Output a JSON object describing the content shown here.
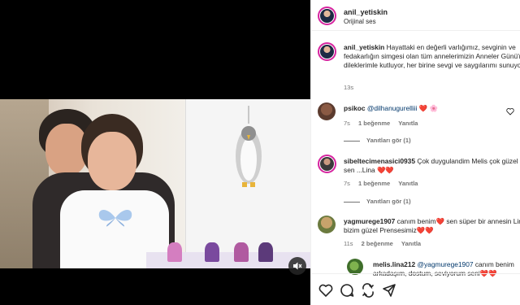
{
  "post": {
    "author": "anil_yetiskin",
    "audio": "Orijinal ses",
    "caption_author": "anil_yetiskin",
    "caption_text": "Hayattaki en değerli varlığımız, sevginin ve fedakarlığın simgesi olan tüm annelerimizin Anneler Günü'nü içten dileklerimle kutluyor, her birine sevgi ve saygılarımı sunuyorum.",
    "caption_time": "13s"
  },
  "comments": [
    {
      "username": "psikoc",
      "text": "@dilhanugurelliii",
      "emojis": "❤️ 🌸",
      "time": "7s",
      "likes": "1 beğenme",
      "reply_label": "Yanıtla",
      "view_replies": "Yanıtları gör (1)"
    },
    {
      "username": "sibeltecimenasici0935",
      "text": "Çok duygulandim Melis çok güzel annesin sen ...Lina",
      "emojis": "❤️❤️",
      "time": "7s",
      "likes": "1 beğenme",
      "reply_label": "Yanıtla",
      "view_replies": "Yanıtları gör (1)"
    },
    {
      "username": "yagmurege1907",
      "text": "canım benim❤️ sen süper bir annesin Linaaa o bizim güzel Prensesimiz❤️❤️",
      "time": "11s",
      "likes": "2 beğenme",
      "reply_label": "Yanıtla"
    },
    {
      "username": "melis.lina212",
      "mention": "@yagmurege1907",
      "text": "canım benim arkadaşım, dostum, seviyorum seni❤️❤️"
    }
  ],
  "icons": {
    "like": "heart-outline-icon",
    "comment": "comment-icon",
    "share": "share-icon",
    "send": "send-icon",
    "mute": "speaker-muted-icon"
  },
  "colors": {
    "heart": "#e0245e",
    "link": "#00376b",
    "muted_text": "#737373"
  }
}
